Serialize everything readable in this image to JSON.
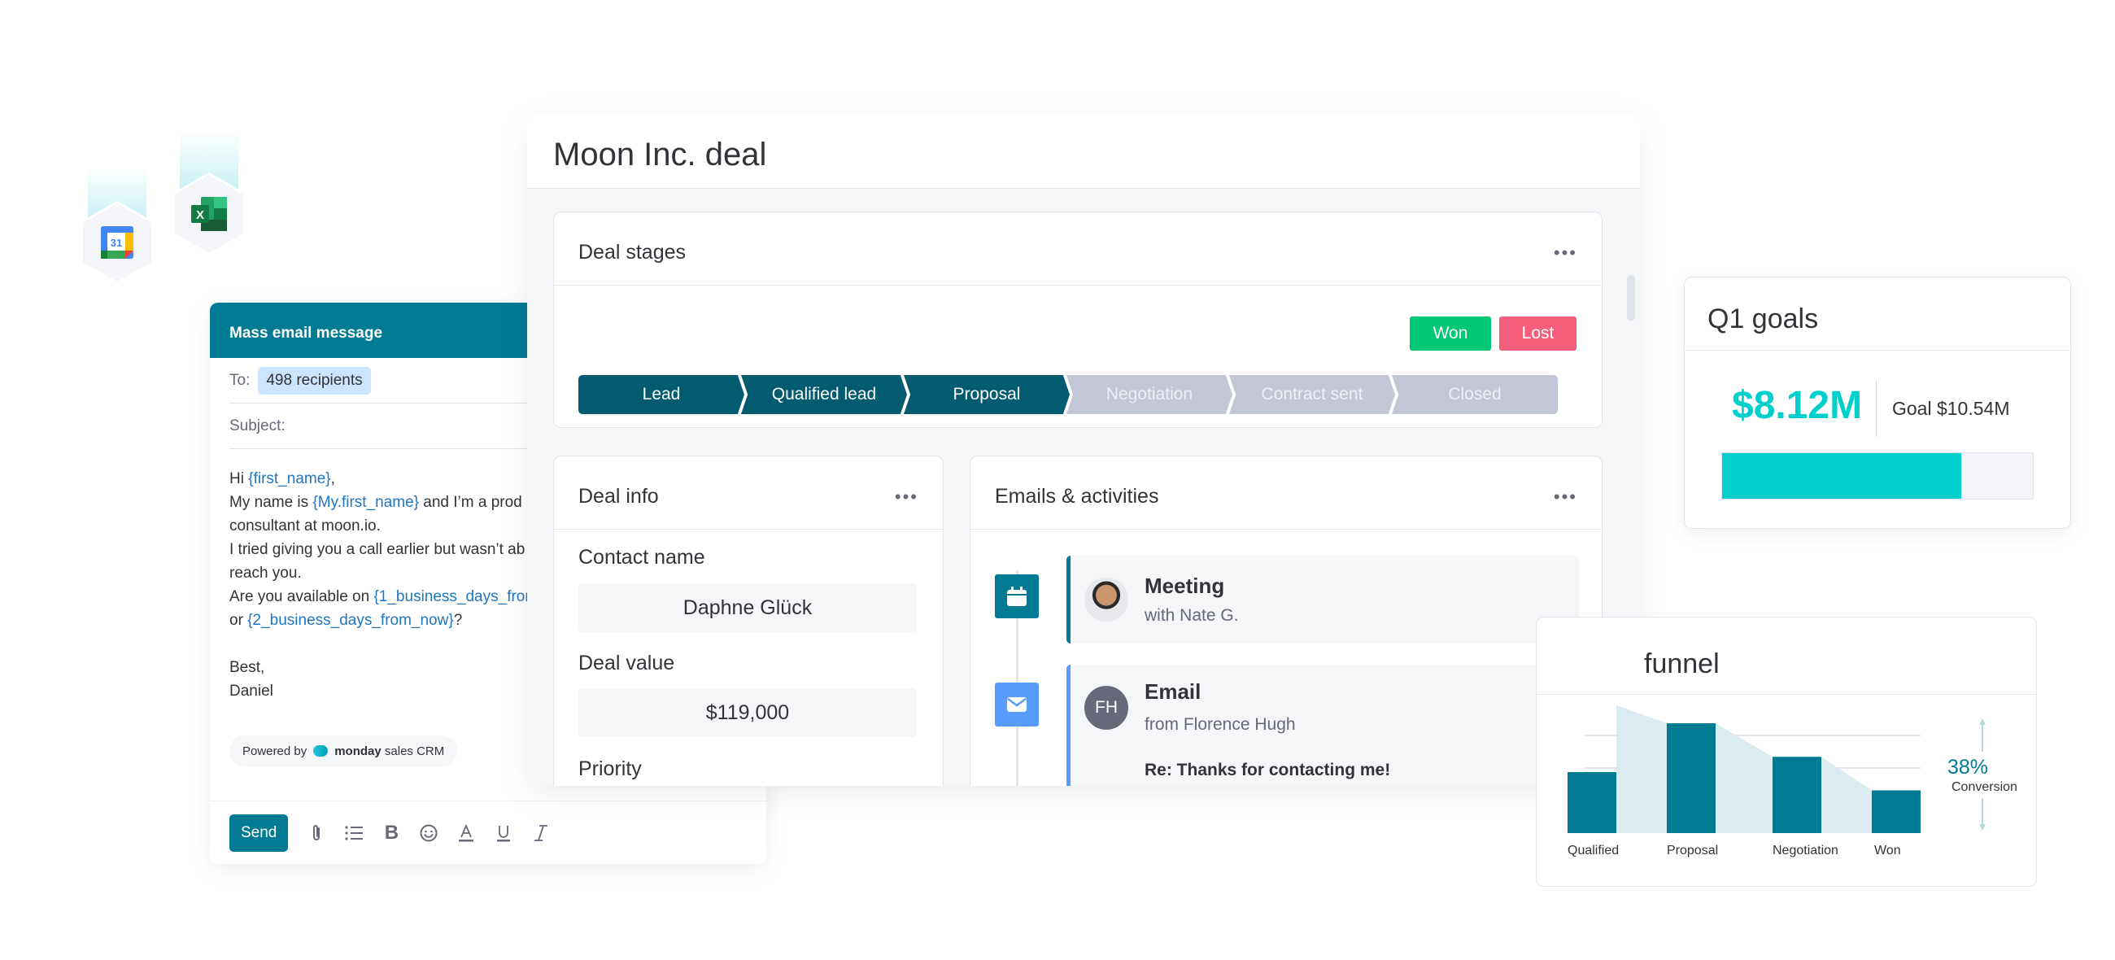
{
  "integrations": [
    {
      "name": "Google Calendar",
      "label": "31"
    },
    {
      "name": "Excel",
      "label": "X"
    }
  ],
  "mass_email": {
    "title": "Mass email message",
    "to_label": "To:",
    "recipients": "498 recipients",
    "subject_label": "Subject:",
    "body": {
      "l1a": "Hi ",
      "l1v": "{first_name}",
      "l1b": ",",
      "l2a": "My name is ",
      "l2v": "{My.first_name}",
      "l2b": " and I’m a prod",
      "l3": "consultant at moon.io.",
      "l4": "I tried giving you a call earlier but wasn’t ab",
      "l5": "reach you.",
      "l6a": "Are you available on ",
      "l6v": "{1_business_days_fron",
      "l7a": "or ",
      "l7v": "{2_business_days_from_now}",
      "l7b": "?",
      "l8": "Best,",
      "l9": "Daniel"
    },
    "powered_by": "Powered by",
    "brand_bold": "monday",
    "brand_rest": "sales CRM",
    "send_label": "Send",
    "toolbar_icons": [
      "paperclip-icon",
      "list-icon",
      "bold-icon",
      "emoji-icon",
      "text-color-icon",
      "underline-icon",
      "italic-icon"
    ]
  },
  "deal": {
    "title": "Moon Inc. deal",
    "stages_card": {
      "title": "Deal stages",
      "won_label": "Won",
      "lost_label": "Lost",
      "stages": [
        {
          "label": "Lead",
          "done": true
        },
        {
          "label": "Qualified lead",
          "done": true
        },
        {
          "label": "Proposal",
          "done": true
        },
        {
          "label": "Negotiation",
          "done": false
        },
        {
          "label": "Contract sent",
          "done": false
        },
        {
          "label": "Closed",
          "done": false
        }
      ]
    },
    "info_card": {
      "title": "Deal info",
      "contact_label": "Contact name",
      "contact_value": "Daphne Glück",
      "value_label": "Deal value",
      "value_value": "$119,000",
      "priority_label": "Priority"
    },
    "activities_card": {
      "title": "Emails & activities",
      "items": [
        {
          "type": "meeting",
          "title": "Meeting",
          "sub": "with Nate G."
        },
        {
          "type": "email",
          "title": "Email",
          "sub": "from Florence Hugh",
          "initials": "FH",
          "subject": "Re: Thanks for contacting me!"
        }
      ]
    }
  },
  "q1_goals": {
    "title": "Q1 goals",
    "current": "$8.12M",
    "goal": "Goal $10.54M",
    "progress": 0.77,
    "color": "#00cfcc"
  },
  "funnel": {
    "title_visible": "funnel",
    "conversion": "38%",
    "conversion_label": "Conversion"
  },
  "chart_data": {
    "type": "bar",
    "title": "funnel",
    "categories": [
      "Qualified",
      "Proposal",
      "Negotiation",
      "Won"
    ],
    "values": [
      100,
      180,
      125,
      70
    ],
    "annotation": "38% Conversion",
    "color": "#007b93",
    "grid": true,
    "legend": "none"
  }
}
